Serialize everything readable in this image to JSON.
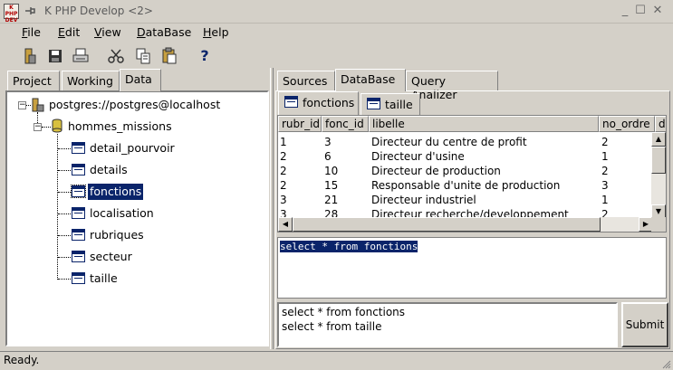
{
  "window": {
    "app_icon_text": "K\nPHP\nDEV",
    "title": "K PHP Develop <2>",
    "minimize_glyph": "_",
    "maximize_glyph": "☐",
    "close_glyph": "✕"
  },
  "menu": {
    "items": [
      {
        "label": "File"
      },
      {
        "label": "Edit"
      },
      {
        "label": "View"
      },
      {
        "label": "DataBase"
      },
      {
        "label": "Help"
      }
    ]
  },
  "toolbar": {
    "buttons": [
      "new-project-icon",
      "save-icon",
      "print-icon",
      "cut-icon",
      "copy-icon",
      "paste-icon",
      "help-icon"
    ],
    "help_glyph": "?"
  },
  "left_tabs": [
    {
      "label": "Project"
    },
    {
      "label": "Working"
    },
    {
      "label": "Data",
      "active": true
    }
  ],
  "tree": {
    "connection": "postgres://postgres@localhost",
    "database": "hommes_missions",
    "tables": [
      {
        "label": "detail_pourvoir"
      },
      {
        "label": "details"
      },
      {
        "label": "fonctions",
        "selected": true
      },
      {
        "label": "localisation"
      },
      {
        "label": "rubriques"
      },
      {
        "label": "secteur"
      },
      {
        "label": "taille"
      }
    ]
  },
  "right_tabs": [
    {
      "label": "Sources"
    },
    {
      "label": "DataBase",
      "active": true
    },
    {
      "label": "Query Analizer"
    }
  ],
  "result_tabs": [
    {
      "label": "fonctions",
      "active": true
    },
    {
      "label": "taille"
    }
  ],
  "grid": {
    "columns": [
      "rubr_id",
      "fonc_id",
      "libelle",
      "no_ordre",
      "da"
    ],
    "rows": [
      [
        "1",
        "3",
        "Directeur du centre de profit",
        "2"
      ],
      [
        "2",
        "6",
        "Directeur d'usine",
        "1"
      ],
      [
        "2",
        "10",
        "Directeur de production",
        "2"
      ],
      [
        "2",
        "15",
        "Responsable d'unite de production",
        "3"
      ],
      [
        "3",
        "21",
        "Directeur industriel",
        "1"
      ],
      [
        "3",
        "28",
        "Directeur recherche/developpement",
        "2"
      ]
    ]
  },
  "sql_editor": {
    "text": "select * from fonctions"
  },
  "history": {
    "items": [
      "select * from fonctions",
      "select * from taille"
    ]
  },
  "submit_label": "Submit",
  "status": {
    "text": "Ready."
  }
}
